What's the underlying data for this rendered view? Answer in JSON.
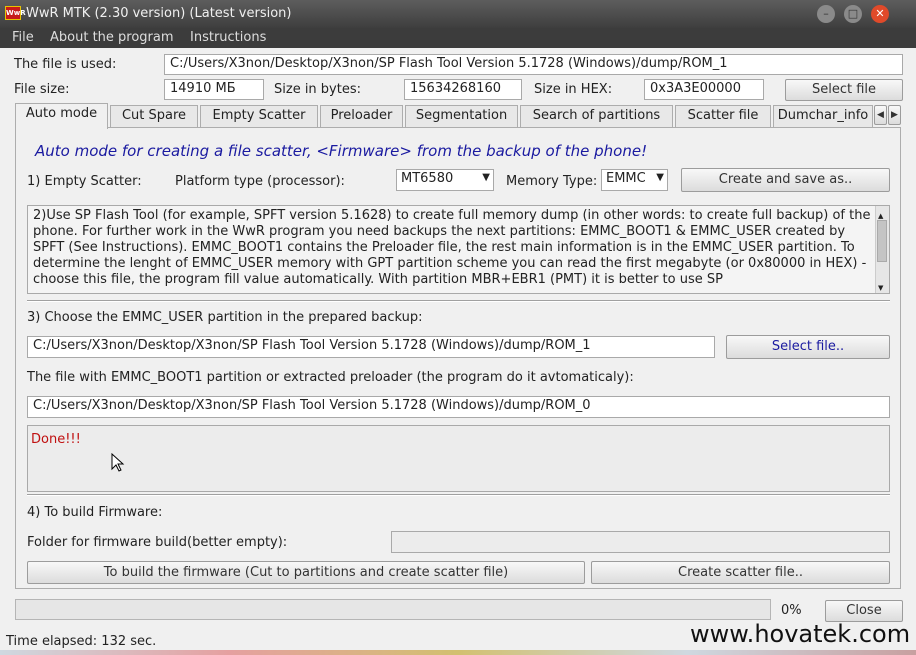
{
  "window": {
    "title": "WwR MTK (2.30 version) (Latest version)",
    "icon_text": "WwR",
    "minimize_symbol": "–",
    "maximize_symbol": "□",
    "close_symbol": "✕"
  },
  "menu": [
    "File",
    "About the program",
    "Instructions"
  ],
  "file_info": {
    "file_used_label": "The file is used:",
    "file_used_value": "C:/Users/X3non/Desktop/X3non/SP Flash Tool Version 5.1728 (Windows)/dump/ROM_1",
    "file_size_label": "File size:",
    "file_size_value": "14910 МБ",
    "size_bytes_label": "Size in bytes:",
    "size_bytes_value": "15634268160",
    "size_hex_label": "Size in HEX:",
    "size_hex_value": "0x3A3E00000",
    "select_file_button": "Select file"
  },
  "tabs": [
    "Auto mode",
    "Cut Spare",
    "Empty Scatter",
    "Preloader",
    "Segmentation",
    "Search of partitions",
    "Scatter file",
    "Dumchar_info"
  ],
  "tab_scroll": {
    "left": "◀",
    "right": "▶"
  },
  "auto_mode": {
    "heading": "Auto mode for creating a file scatter, <Firmware> from the backup of the phone!",
    "step1_label": "1) Empty Scatter:",
    "platform_label": "Platform type (processor):",
    "platform_value": "MT6580",
    "memory_label": "Memory Type:",
    "memory_value": "EMMC",
    "create_save_button": "Create and save as..",
    "instructions": "2)Use SP Flash Tool (for example, SPFT version 5.1628) to create full memory dump (in other words: to create full backup) of the phone. For further work in the WwR program you need backups the next partitions: EMMC_BOOT1 & EMMC_USER created by SPFT (See Instructions). EMMC_BOOT1 contains the Preloader file, the rest main information is in the EMMC_USER partition. To determine the lenght of EMMC_USER memory with GPT partition scheme you can read the first megabyte (or 0x80000 in HEX) - choose this file, the program fill value automatically. With partition MBR+EBR1 (PMT) it is better to use SP",
    "step3_label": "3) Choose the EMMC_USER partition in the prepared backup:",
    "emmc_user_path": "C:/Users/X3non/Desktop/X3non/SP Flash Tool Version 5.1728 (Windows)/dump/ROM_1",
    "select_file2_button": "Select file..",
    "boot1_label": "The file with EMMC_BOOT1 partition or extracted preloader (the program do it avtomaticaly):",
    "boot1_path": "C:/Users/X3non/Desktop/X3non/SP Flash Tool Version 5.1728 (Windows)/dump/ROM_0",
    "log_text": "Done!!!",
    "step4_label": "4) To build Firmware:",
    "folder_label": "Folder for firmware build(better empty):",
    "folder_value": "",
    "build_button": "To build the firmware (Cut to partitions and create scatter file)",
    "create_scatter_button": "Create scatter file.."
  },
  "footer": {
    "progress_percent": "0%",
    "progress_value": 0,
    "close_button": "Close",
    "time_elapsed": "Time elapsed: 132 sec.",
    "watermark": "www.hovatek.com"
  },
  "colors": {
    "heading": "#1a1aa0",
    "done_text": "#c01010",
    "titlebar": "#4a4a4a"
  }
}
